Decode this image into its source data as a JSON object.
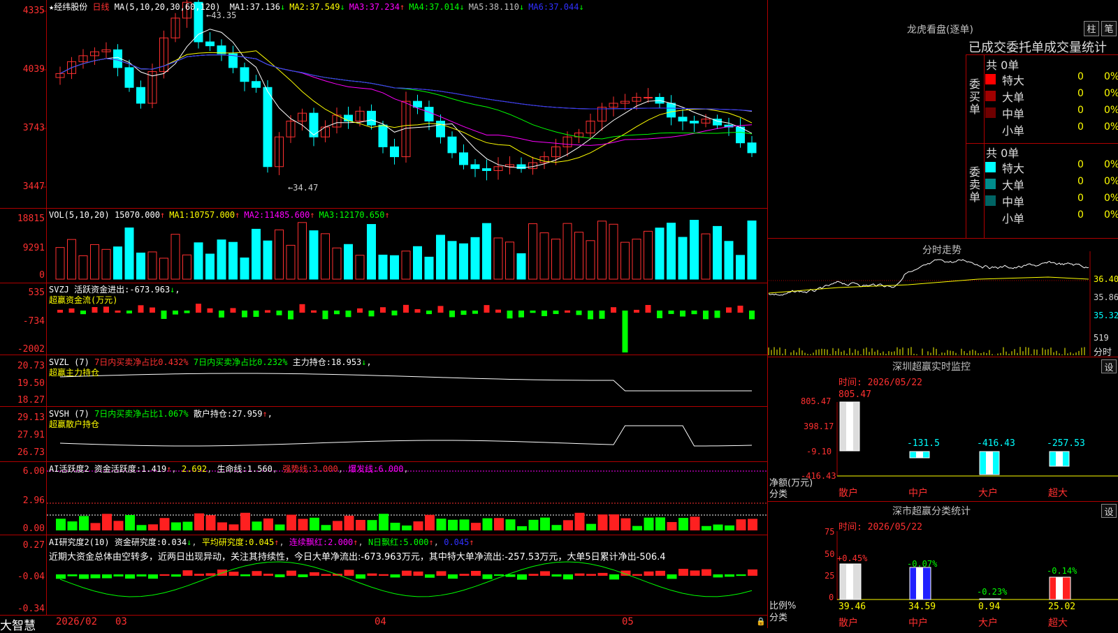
{
  "app": {
    "brand": "大智慧",
    "brand_label": "大智慧"
  },
  "kline": {
    "header": {
      "star": "★",
      "stock": "经纬股份",
      "period": "日线",
      "ma_params": "MA(5,10,20,30,60,120)",
      "items": [
        {
          "label": "MA1:",
          "value": "37.136",
          "arrow": "↓",
          "color": "#ffffff"
        },
        {
          "label": "MA2:",
          "value": "37.549",
          "arrow": "↓",
          "color": "#ffff00"
        },
        {
          "label": "MA3:",
          "value": "37.234",
          "arrow": "↑",
          "color": "#ff00ff"
        },
        {
          "label": "MA4:",
          "value": "37.014",
          "arrow": "↓",
          "color": "#00ff00"
        },
        {
          "label": "MA5:",
          "value": "38.110",
          "arrow": "↓",
          "color": "#c0c0c0"
        },
        {
          "label": "MA6:",
          "value": "37.044",
          "arrow": "↓",
          "color": "#3030ff"
        }
      ]
    },
    "yticks": [
      "4335",
      "4039",
      "3743",
      "3447"
    ],
    "high_label": "43.35",
    "low_label": "34.47"
  },
  "volume": {
    "header": {
      "params": "VOL(5,10,20)",
      "value": "15070.000",
      "arrow": "↑",
      "items": [
        {
          "label": "MA1:",
          "value": "10757.000",
          "arrow": "↑",
          "color": "#ffff00"
        },
        {
          "label": "MA2:",
          "value": "11485.600",
          "arrow": "↑",
          "color": "#ff00ff"
        },
        {
          "label": "MA3:",
          "value": "12170.650",
          "arrow": "↑",
          "color": "#00ff00"
        }
      ]
    },
    "yticks": [
      "18815",
      "9291",
      "0"
    ]
  },
  "svzj": {
    "name": "SVZJ",
    "label": "活跃资金进出:",
    "value": "-673.963",
    "arrow": "↓",
    "subtitle": "超赢资金流(万元)",
    "yticks": [
      "535",
      "-734",
      "-2002"
    ]
  },
  "svzl": {
    "name": "SVZL",
    "param": "(7)",
    "t1": "7日内买卖净占比0.432%",
    "t2": "7日内买卖净占比0.232%",
    "label": "主力持仓:",
    "value": "18.953",
    "arrow": "↓",
    "comma": ",",
    "subtitle": "超赢主力持仓",
    "yticks": [
      "20.73",
      "19.50",
      "18.27"
    ]
  },
  "svsh": {
    "name": "SVSH",
    "param": "(7)",
    "t1": "7日内买卖净占比1.067%",
    "label": "散户持仓:",
    "value": "27.959",
    "arrow": "↑",
    "comma": ",",
    "subtitle": "超赢散户持仓",
    "yticks": [
      "29.13",
      "27.91",
      "26.73"
    ]
  },
  "ai1": {
    "name": "AI活跃度2",
    "label": "资金活跃度:",
    "v1": "1.419",
    "a1": "↑",
    "v2": "2.692",
    "label2": "生命线:",
    "v3": "1.560",
    "qs": "强势线:",
    "qsv": "3.000",
    "bf": "爆发线:",
    "bfv": "6.000",
    "yticks": [
      "6.00",
      "2.96",
      "0.00"
    ]
  },
  "ai2": {
    "name": "AI研究度2(10)",
    "label": "资金研究度:",
    "v1": "0.034",
    "a1": "↓",
    "l2": "平均研究度:",
    "v2": "0.045",
    "a2": "↑",
    "l3": "连续飘红:",
    "v3": "2.000",
    "a3": "↑",
    "l4": "N日飘红:",
    "v4": "5.000",
    "a4": "↑",
    "v5": "0.045",
    "a5": "↑",
    "comment": "近期大资金总体由空转多，近两日出现异动，关注其持续性，今日大单净流出:-673.963万元，其中特大单净流出:-257.53万元，大单5日累计净出-506.4",
    "yticks": [
      "0.27",
      "-0.04",
      "-0.34"
    ]
  },
  "xaxis": {
    "labels": [
      "2026/02",
      "03",
      "04",
      "05"
    ]
  },
  "lhb": {
    "title": "龙虎看盘(逐单)",
    "btn1": "柱",
    "btn2": "笔",
    "stats_title": "已成交委托单成交量统计",
    "buy": {
      "side": "委买单",
      "total": "共 0单",
      "rows": [
        {
          "label": "特大",
          "v": "0",
          "p": "0%",
          "color": "#ff0000"
        },
        {
          "label": "大单",
          "v": "0",
          "p": "0%",
          "color": "#a00000"
        },
        {
          "label": "中单",
          "v": "0",
          "p": "0%",
          "color": "#700000"
        },
        {
          "label": "小单",
          "v": "0",
          "p": "0%",
          "color": "#000000"
        }
      ]
    },
    "sell": {
      "side": "委卖单",
      "total": "共 0单",
      "rows": [
        {
          "label": "特大",
          "v": "0",
          "p": "0%",
          "color": "#00ffff"
        },
        {
          "label": "大单",
          "v": "0",
          "p": "0%",
          "color": "#008c8c"
        },
        {
          "label": "中单",
          "v": "0",
          "p": "0%",
          "color": "#006464"
        },
        {
          "label": "小单",
          "v": "0",
          "p": "0%",
          "color": "#000000"
        }
      ]
    }
  },
  "fenshi": {
    "title": "分时走势",
    "yticks": [
      "36.40",
      "35.86",
      "35.32"
    ],
    "vol_label": "519",
    "label": "分时"
  },
  "monitor": {
    "title": "深圳超赢实时监控",
    "btn": "设",
    "time": "时间: 2026/05/22",
    "yticks": [
      "805.47",
      "398.17",
      "-9.10",
      "-416.43"
    ],
    "ylabel": "净额(万元)",
    "xlabel": "分类",
    "bars": [
      {
        "cat": "散户",
        "value": "805.47"
      },
      {
        "cat": "中户",
        "value": "-131.5"
      },
      {
        "cat": "大户",
        "value": "-416.43"
      },
      {
        "cat": "超大",
        "value": "-257.53"
      }
    ]
  },
  "classify": {
    "title": "深市超赢分类统计",
    "btn": "设",
    "time": "时间: 2026/05/22",
    "yticks": [
      "75",
      "50",
      "25",
      "0"
    ],
    "ylabel": "比例%",
    "xlabel": "分类",
    "bars": [
      {
        "cat": "散户",
        "top": "+0.45%",
        "bottom": "39.46"
      },
      {
        "cat": "中户",
        "top": "-0.07%",
        "bottom": "34.59"
      },
      {
        "cat": "大户",
        "top": "-0.23%",
        "bottom": "0.94"
      },
      {
        "cat": "超大",
        "top": "-0.14%",
        "bottom": "25.02"
      }
    ]
  },
  "colors": {
    "up": "#ff3030",
    "down": "#00ffff",
    "grid": "#b00000"
  },
  "chart_data": {
    "type": "candlestick",
    "title": "经纬股份 日线",
    "ma": [
      "MA1",
      "MA2",
      "MA3",
      "MA4",
      "MA5",
      "MA6"
    ]
  }
}
